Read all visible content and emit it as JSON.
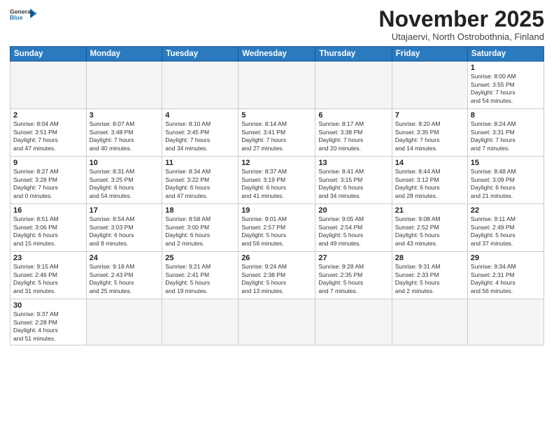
{
  "header": {
    "logo_line1": "General",
    "logo_line2": "Blue",
    "month": "November 2025",
    "location": "Utajaervi, North Ostrobothnia, Finland"
  },
  "weekdays": [
    "Sunday",
    "Monday",
    "Tuesday",
    "Wednesday",
    "Thursday",
    "Friday",
    "Saturday"
  ],
  "weeks": [
    [
      {
        "day": "",
        "info": ""
      },
      {
        "day": "",
        "info": ""
      },
      {
        "day": "",
        "info": ""
      },
      {
        "day": "",
        "info": ""
      },
      {
        "day": "",
        "info": ""
      },
      {
        "day": "",
        "info": ""
      },
      {
        "day": "1",
        "info": "Sunrise: 8:00 AM\nSunset: 3:55 PM\nDaylight: 7 hours\nand 54 minutes."
      }
    ],
    [
      {
        "day": "2",
        "info": "Sunrise: 8:04 AM\nSunset: 3:51 PM\nDaylight: 7 hours\nand 47 minutes."
      },
      {
        "day": "3",
        "info": "Sunrise: 8:07 AM\nSunset: 3:48 PM\nDaylight: 7 hours\nand 40 minutes."
      },
      {
        "day": "4",
        "info": "Sunrise: 8:10 AM\nSunset: 3:45 PM\nDaylight: 7 hours\nand 34 minutes."
      },
      {
        "day": "5",
        "info": "Sunrise: 8:14 AM\nSunset: 3:41 PM\nDaylight: 7 hours\nand 27 minutes."
      },
      {
        "day": "6",
        "info": "Sunrise: 8:17 AM\nSunset: 3:38 PM\nDaylight: 7 hours\nand 20 minutes."
      },
      {
        "day": "7",
        "info": "Sunrise: 8:20 AM\nSunset: 3:35 PM\nDaylight: 7 hours\nand 14 minutes."
      },
      {
        "day": "8",
        "info": "Sunrise: 8:24 AM\nSunset: 3:31 PM\nDaylight: 7 hours\nand 7 minutes."
      }
    ],
    [
      {
        "day": "9",
        "info": "Sunrise: 8:27 AM\nSunset: 3:28 PM\nDaylight: 7 hours\nand 0 minutes."
      },
      {
        "day": "10",
        "info": "Sunrise: 8:31 AM\nSunset: 3:25 PM\nDaylight: 6 hours\nand 54 minutes."
      },
      {
        "day": "11",
        "info": "Sunrise: 8:34 AM\nSunset: 3:22 PM\nDaylight: 6 hours\nand 47 minutes."
      },
      {
        "day": "12",
        "info": "Sunrise: 8:37 AM\nSunset: 3:19 PM\nDaylight: 6 hours\nand 41 minutes."
      },
      {
        "day": "13",
        "info": "Sunrise: 8:41 AM\nSunset: 3:15 PM\nDaylight: 6 hours\nand 34 minutes."
      },
      {
        "day": "14",
        "info": "Sunrise: 8:44 AM\nSunset: 3:12 PM\nDaylight: 6 hours\nand 28 minutes."
      },
      {
        "day": "15",
        "info": "Sunrise: 8:48 AM\nSunset: 3:09 PM\nDaylight: 6 hours\nand 21 minutes."
      }
    ],
    [
      {
        "day": "16",
        "info": "Sunrise: 8:51 AM\nSunset: 3:06 PM\nDaylight: 6 hours\nand 15 minutes."
      },
      {
        "day": "17",
        "info": "Sunrise: 8:54 AM\nSunset: 3:03 PM\nDaylight: 6 hours\nand 8 minutes."
      },
      {
        "day": "18",
        "info": "Sunrise: 8:58 AM\nSunset: 3:00 PM\nDaylight: 6 hours\nand 2 minutes."
      },
      {
        "day": "19",
        "info": "Sunrise: 9:01 AM\nSunset: 2:57 PM\nDaylight: 5 hours\nand 56 minutes."
      },
      {
        "day": "20",
        "info": "Sunrise: 9:05 AM\nSunset: 2:54 PM\nDaylight: 5 hours\nand 49 minutes."
      },
      {
        "day": "21",
        "info": "Sunrise: 9:08 AM\nSunset: 2:52 PM\nDaylight: 5 hours\nand 43 minutes."
      },
      {
        "day": "22",
        "info": "Sunrise: 9:11 AM\nSunset: 2:49 PM\nDaylight: 5 hours\nand 37 minutes."
      }
    ],
    [
      {
        "day": "23",
        "info": "Sunrise: 9:15 AM\nSunset: 2:46 PM\nDaylight: 5 hours\nand 31 minutes."
      },
      {
        "day": "24",
        "info": "Sunrise: 9:18 AM\nSunset: 2:43 PM\nDaylight: 5 hours\nand 25 minutes."
      },
      {
        "day": "25",
        "info": "Sunrise: 9:21 AM\nSunset: 2:41 PM\nDaylight: 5 hours\nand 19 minutes."
      },
      {
        "day": "26",
        "info": "Sunrise: 9:24 AM\nSunset: 2:38 PM\nDaylight: 5 hours\nand 13 minutes."
      },
      {
        "day": "27",
        "info": "Sunrise: 9:28 AM\nSunset: 2:35 PM\nDaylight: 5 hours\nand 7 minutes."
      },
      {
        "day": "28",
        "info": "Sunrise: 9:31 AM\nSunset: 2:33 PM\nDaylight: 5 hours\nand 2 minutes."
      },
      {
        "day": "29",
        "info": "Sunrise: 9:34 AM\nSunset: 2:31 PM\nDaylight: 4 hours\nand 56 minutes."
      }
    ],
    [
      {
        "day": "30",
        "info": "Sunrise: 9:37 AM\nSunset: 2:28 PM\nDaylight: 4 hours\nand 51 minutes."
      },
      {
        "day": "",
        "info": ""
      },
      {
        "day": "",
        "info": ""
      },
      {
        "day": "",
        "info": ""
      },
      {
        "day": "",
        "info": ""
      },
      {
        "day": "",
        "info": ""
      },
      {
        "day": "",
        "info": ""
      }
    ]
  ]
}
